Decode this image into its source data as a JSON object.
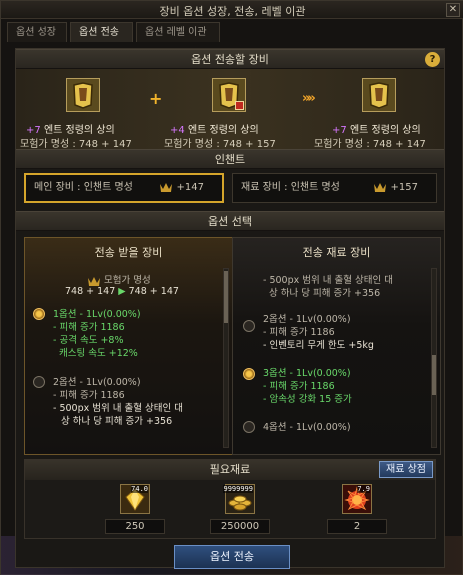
{
  "window": {
    "title": "장비 옵션 성장, 전송, 레벨 이관"
  },
  "tabs": [
    {
      "label": "옵션 성장",
      "active": false
    },
    {
      "label": "옵션 전송",
      "active": true
    },
    {
      "label": "옵션 레벨 이관",
      "active": false
    }
  ],
  "transfer": {
    "header": "옵션 전송할 장비",
    "help": "?",
    "items": [
      {
        "plus": "+7",
        "name": "엔트 정령의 상의",
        "fame": "모험가 명성 : 748 + 147"
      },
      {
        "plus": "+4",
        "name": "엔트 정령의 상의",
        "fame": "모험가 명성 : 748 + 157"
      },
      {
        "plus": "+7",
        "name": "엔트 정령의 상의",
        "fame": "모험가 명성 : 748 + 147"
      }
    ],
    "plus_sign": "+",
    "arrows": "»»"
  },
  "enchant": {
    "header": "인챈트",
    "main_label": "메인 장비 : 인챈트 명성",
    "main_value": "+147",
    "mat_label": "재료 장비 : 인챈트 명성",
    "mat_value": "+157"
  },
  "options": {
    "header": "옵션 선택",
    "left": {
      "title": "전송 받을 장비",
      "fame_label": "모험가 명성",
      "fame_calc_a": "748 + 147",
      "fame_arrow": "▶",
      "fame_calc_b": "748 + 147",
      "opt1": {
        "title": "1옵션 - 1Lv(0.00%)",
        "l1": "- 피해 증가 1186",
        "l2": "- 공격 속도 +8%",
        "l3": "캐스팅 속도 +12%"
      },
      "opt2": {
        "title": "2옵션 - 1Lv(0.00%)",
        "l1": "- 피해 증가 1186",
        "l2": "- 500px 범위 내 출혈 상태인 대",
        "l3": "상 하나 당 피해 증가 +356"
      }
    },
    "right": {
      "title": "전송 재료 장비",
      "pre1": "- 500px 범위 내 출혈 상태인 대",
      "pre2": "상 하나 당 피해 증가 +356",
      "opt2": {
        "title": "2옵션 - 1Lv(0.00%)",
        "l1": "- 피해 증가 1186",
        "l2": "- 인벤토리 무게 한도 +5kg"
      },
      "opt3": {
        "title": "3옵션 - 1Lv(0.00%)",
        "l1": "- 피해 증가 1186",
        "l2": "- 암속성 강화 15 증가"
      },
      "opt4": {
        "title": "4옵션 - 1Lv(0.00%)"
      }
    }
  },
  "materials": {
    "header": "필요재료",
    "shop_label": "재료 상점",
    "items": [
      {
        "icon": "gold-crystal-icon",
        "badge": "74.0",
        "count": "250"
      },
      {
        "icon": "gold-coins-icon",
        "badge": "9999999",
        "count": "250000"
      },
      {
        "icon": "red-orb-icon",
        "badge": "7.9",
        "count": "2"
      }
    ]
  },
  "action": {
    "label": "옵션 전송"
  },
  "colors": {
    "accent_gold": "#d5a52b",
    "option_green": "#69d86a",
    "purple_plus": "#d677ff",
    "button_blue": "#2f4f7e"
  }
}
